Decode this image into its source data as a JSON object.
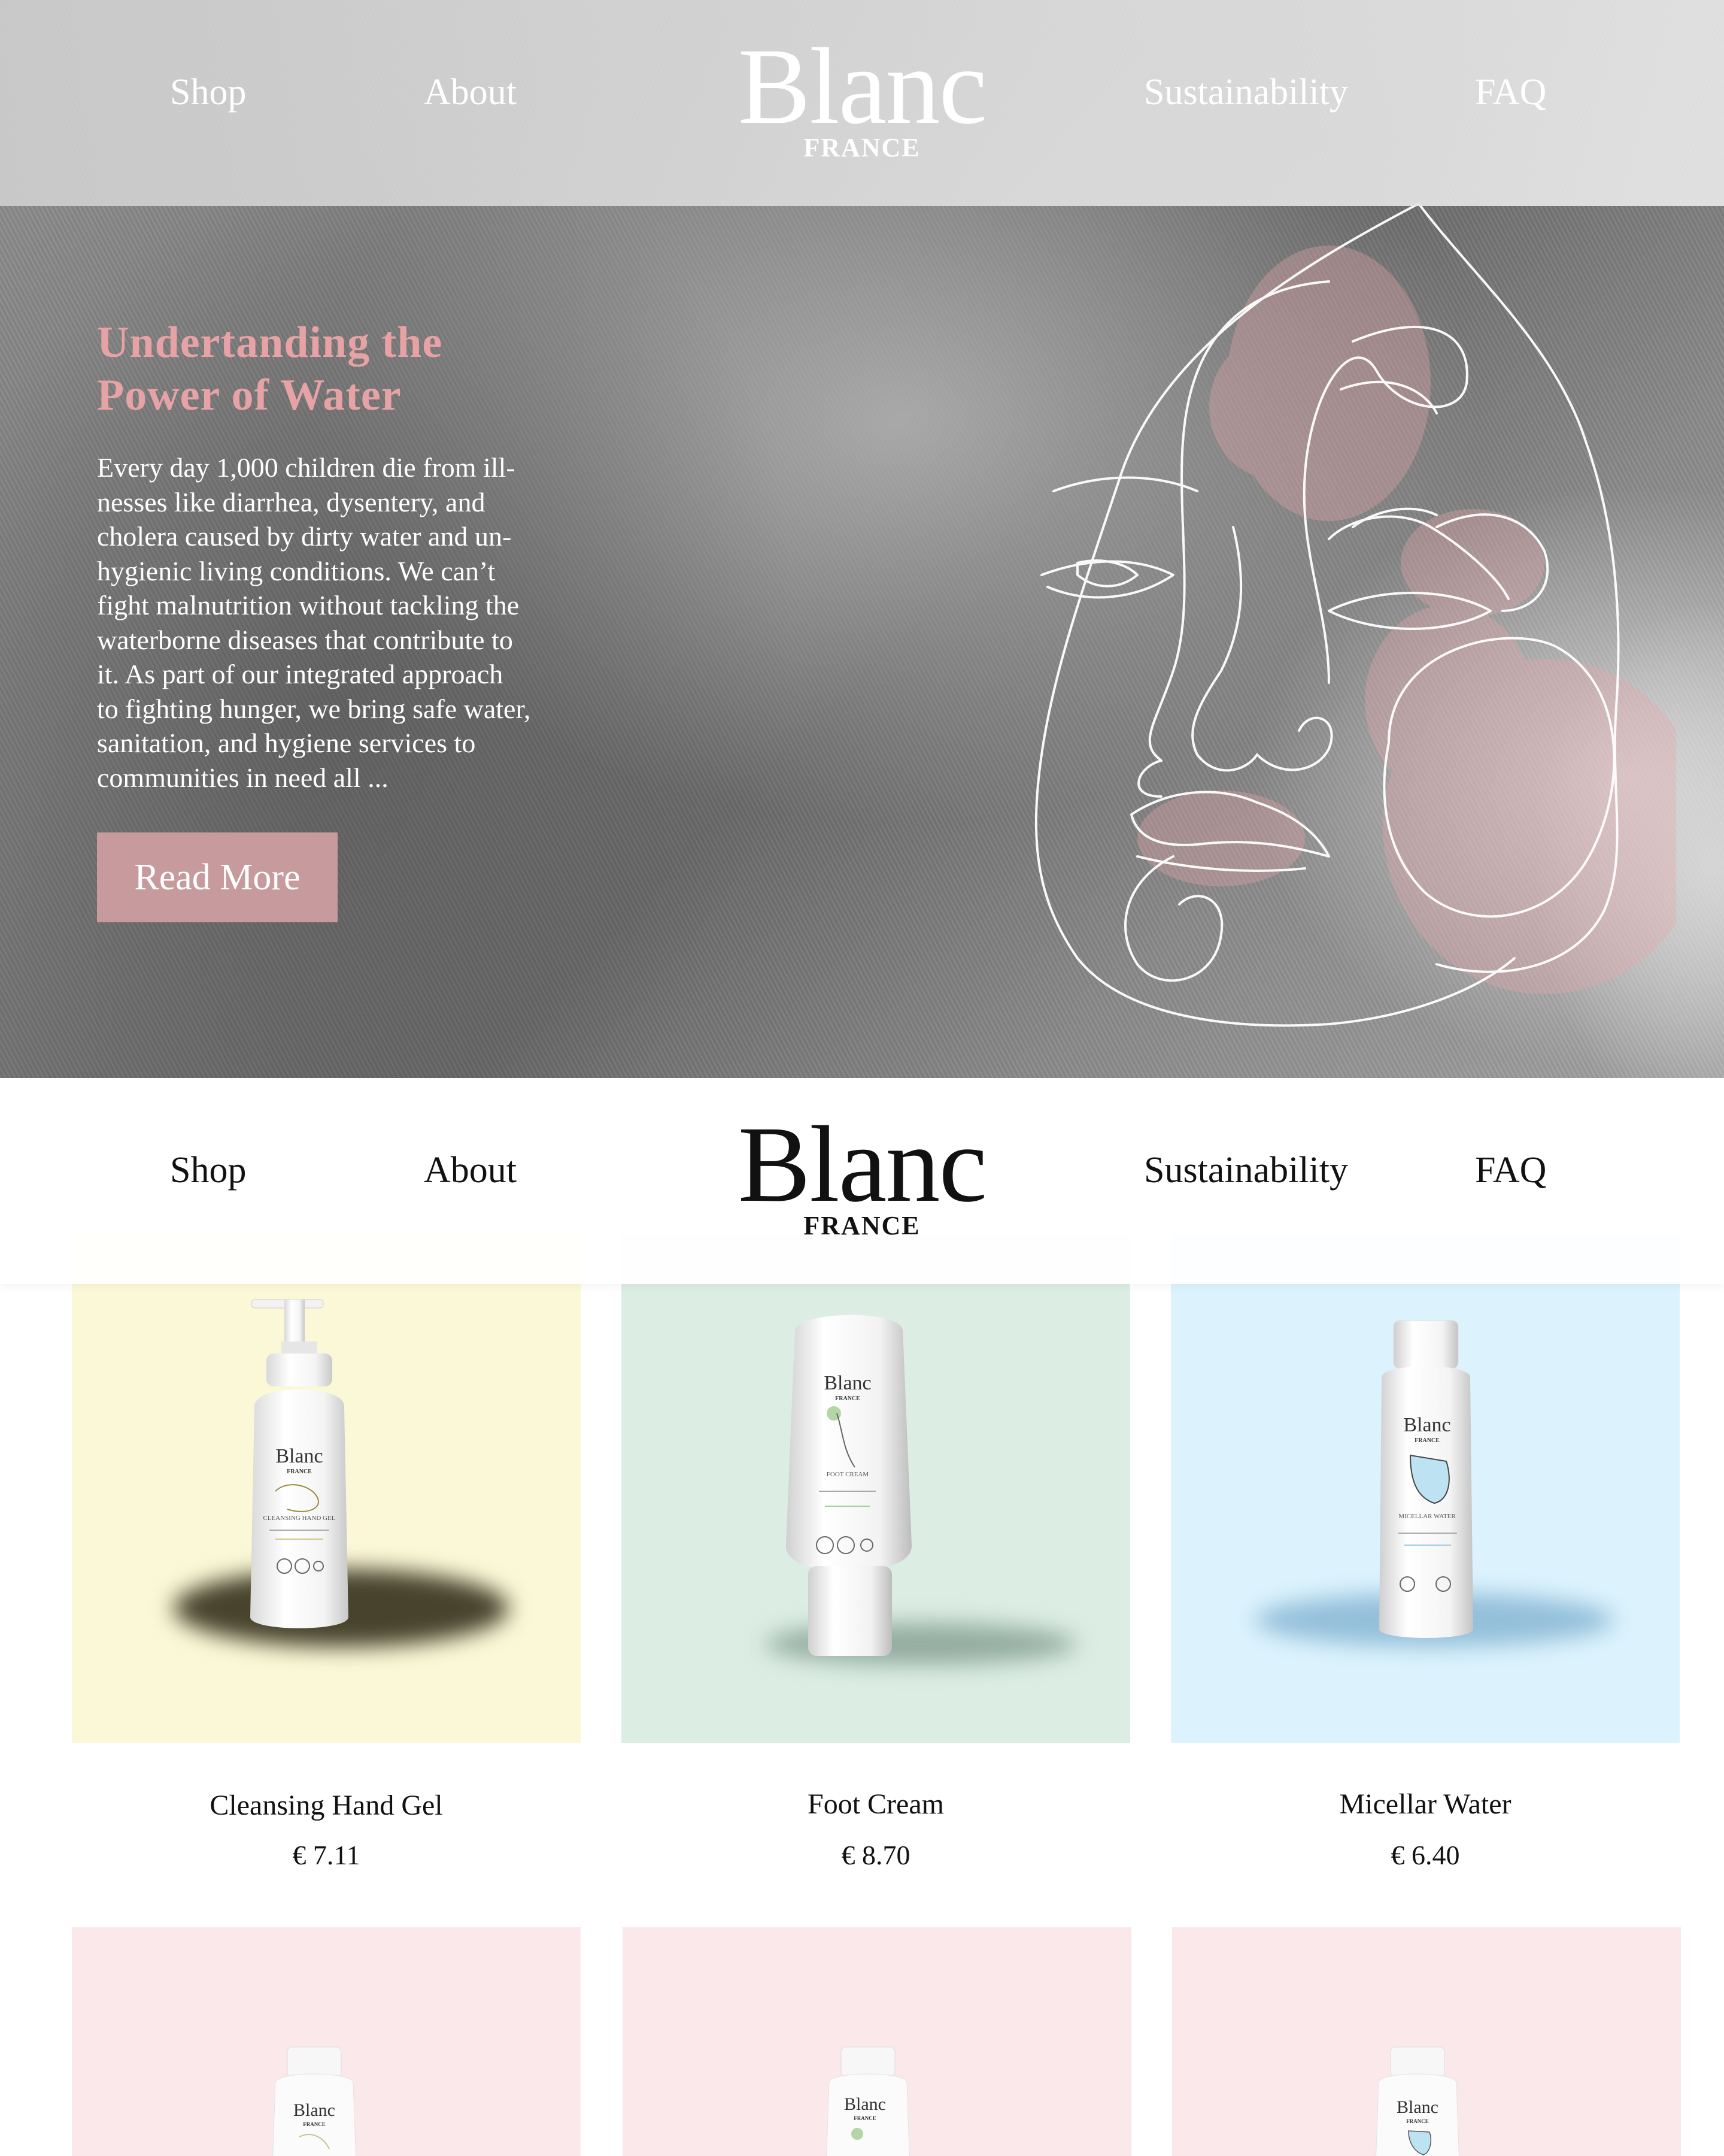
{
  "brand": {
    "name": "Blanc",
    "sub": "FRANCE"
  },
  "nav": {
    "links": [
      "Shop",
      "About",
      "Sustainability",
      "FAQ"
    ]
  },
  "hero": {
    "title_line1": "Undertanding the",
    "title_line2": "Power of Water",
    "body_lines": [
      "Every day 1,000 children die from ill-",
      "nesses like diarrhea, dysentery, and",
      "cholera caused by dirty water and un-",
      "hygienic living conditions. We can’t",
      "fight malnutrition without tackling the",
      "waterborne diseases that contribute to",
      "it. As part of our integrated approach",
      "to fighting hunger, we bring safe water,",
      "sanitation, and hygiene services to",
      "communities in need all ..."
    ],
    "button": "Read More",
    "accent_color": "#e7a2a6",
    "button_color": "#c79a9d"
  },
  "products": [
    {
      "name": "Cleansing Hand Gel",
      "price": "€ 7.11",
      "bg": "#fbf8d7",
      "label": "CLEANSING HAND GEL",
      "shadow": "#3a3418"
    },
    {
      "name": "Foot Cream",
      "price": "€ 8.70",
      "bg": "#dcede4",
      "label": "FOOT CREAM",
      "shadow": "#6f8a7c"
    },
    {
      "name": "Micellar Water",
      "price": "€ 6.40",
      "bg": "#dcf3fd",
      "label": "MICELLAR WATER",
      "shadow": "#6aa9c8"
    }
  ],
  "products_row2": [
    {
      "bg": "#fbe8ea"
    },
    {
      "bg": "#fbe8ea"
    },
    {
      "bg": "#fbe8ea"
    }
  ]
}
